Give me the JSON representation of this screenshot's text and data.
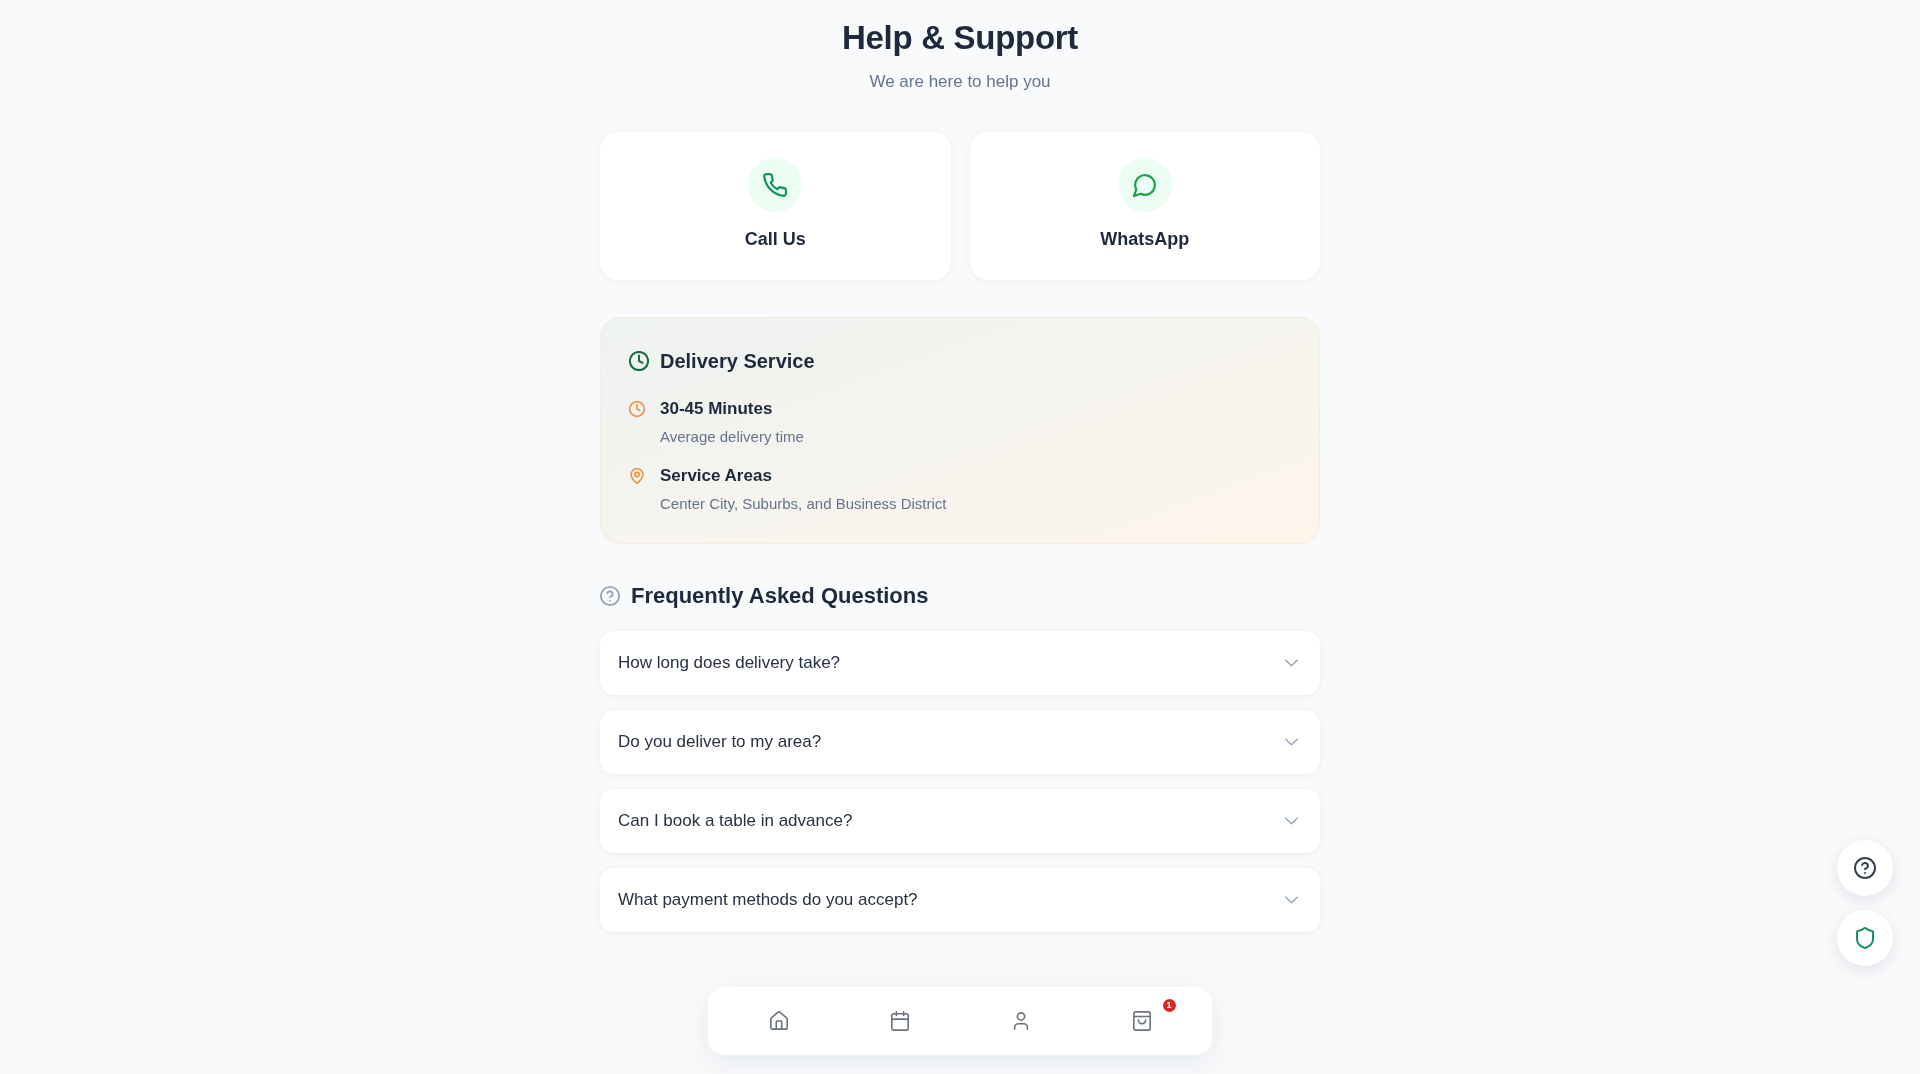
{
  "header": {
    "title": "Help & Support",
    "subtitle": "We are here to help you"
  },
  "contact_options": [
    {
      "kind": "phone",
      "label": "Call Us"
    },
    {
      "kind": "chat",
      "label": "WhatsApp"
    }
  ],
  "delivery": {
    "title": "Delivery Service",
    "items": [
      {
        "kind": "time",
        "title": "30-45 Minutes",
        "description": "Average delivery time"
      },
      {
        "kind": "location",
        "title": "Service Areas",
        "description": "Center City, Suburbs, and Business District"
      }
    ]
  },
  "faq": {
    "title": "Frequently Asked Questions",
    "items": [
      {
        "question": "How long does delivery take?",
        "expanded": false
      },
      {
        "question": "Do you deliver to my area?",
        "expanded": false
      },
      {
        "question": "Can I book a table in advance?",
        "expanded": false
      },
      {
        "question": "What payment methods do you accept?",
        "expanded": false
      }
    ]
  },
  "bottom_nav": [
    {
      "kind": "home",
      "selected": false
    },
    {
      "kind": "calendar",
      "selected": false
    },
    {
      "kind": "person",
      "selected": false
    },
    {
      "kind": "bag",
      "selected": false,
      "badge": "1"
    }
  ],
  "floating_buttons": [
    {
      "kind": "help"
    },
    {
      "kind": "shield"
    }
  ]
}
